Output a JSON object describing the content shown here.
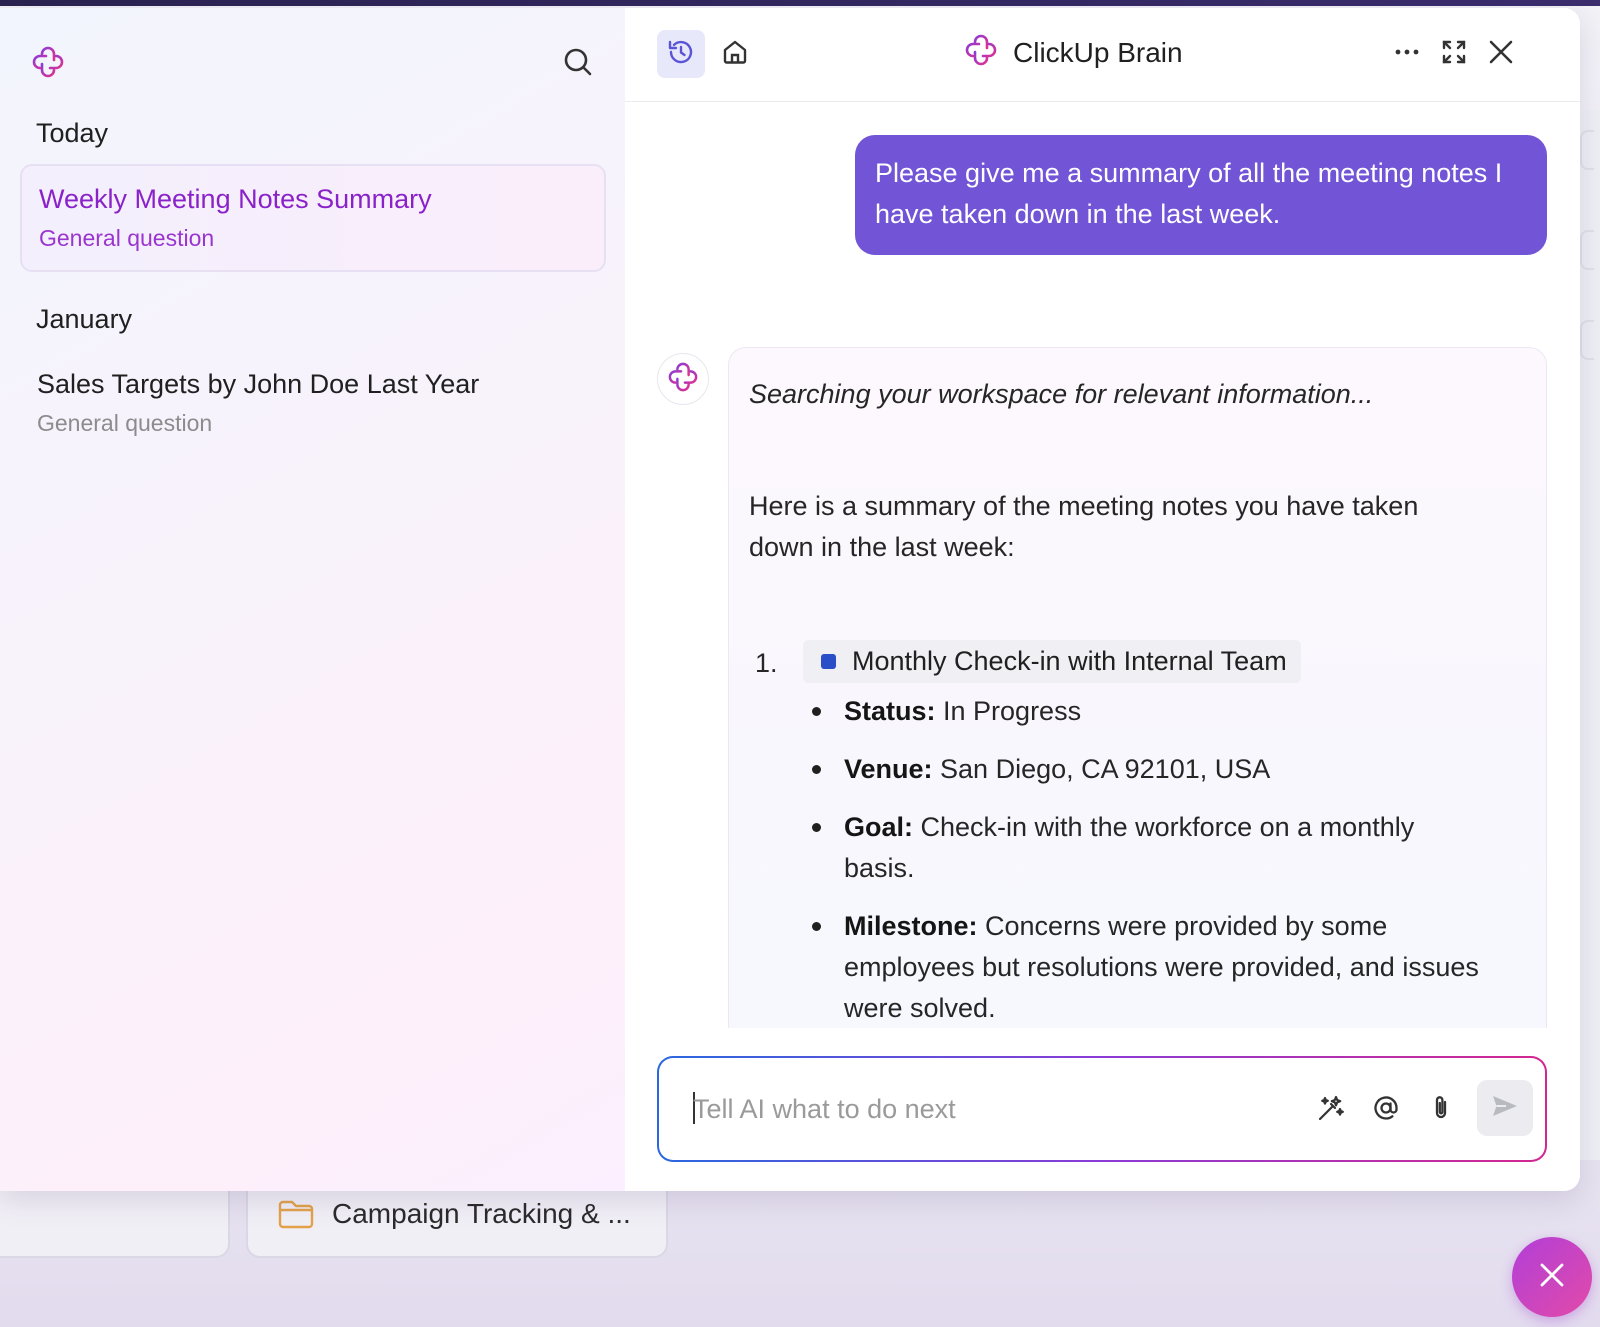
{
  "sidebar": {
    "sections": [
      {
        "title": "Today",
        "items": [
          {
            "title": "Weekly Meeting Notes Summary",
            "subtitle": "General question"
          }
        ]
      },
      {
        "title": "January",
        "items": [
          {
            "title": "Sales Targets by John Doe Last Year",
            "subtitle": "General question"
          }
        ]
      }
    ]
  },
  "header": {
    "title": "ClickUp Brain",
    "icons": [
      "history-icon",
      "home-icon",
      "more-icon",
      "expand-icon",
      "close-icon"
    ]
  },
  "conversation": {
    "user_message": "Please give me a summary of all the meeting notes I have taken down in the last week.",
    "ai": {
      "status": "Searching your workspace for relevant information...",
      "intro": "Here is a summary of the meeting notes you have taken down in the last week:",
      "list": [
        {
          "number": "1.",
          "task": "Monthly Check-in with Internal Team",
          "task_color": "#2a4ec7",
          "fields": [
            {
              "label": "Status:",
              "value": " In Progress"
            },
            {
              "label": "Venue:",
              "value": " San Diego, CA 92101, USA"
            },
            {
              "label": "Goal:",
              "value": " Check-in with the workforce on a monthly basis."
            },
            {
              "label": "Milestone:",
              "value": " Concerns were provided by some employees but resolutions were provided, and issues were solved."
            }
          ]
        }
      ]
    }
  },
  "composer": {
    "placeholder": "Tell AI what to do next",
    "value": ""
  },
  "background": {
    "card_label": "Campaign Tracking & ..."
  },
  "colors": {
    "user_bubble": "#7155d6",
    "active_item_text": "#8a22c9",
    "fab": "#c743c6"
  }
}
